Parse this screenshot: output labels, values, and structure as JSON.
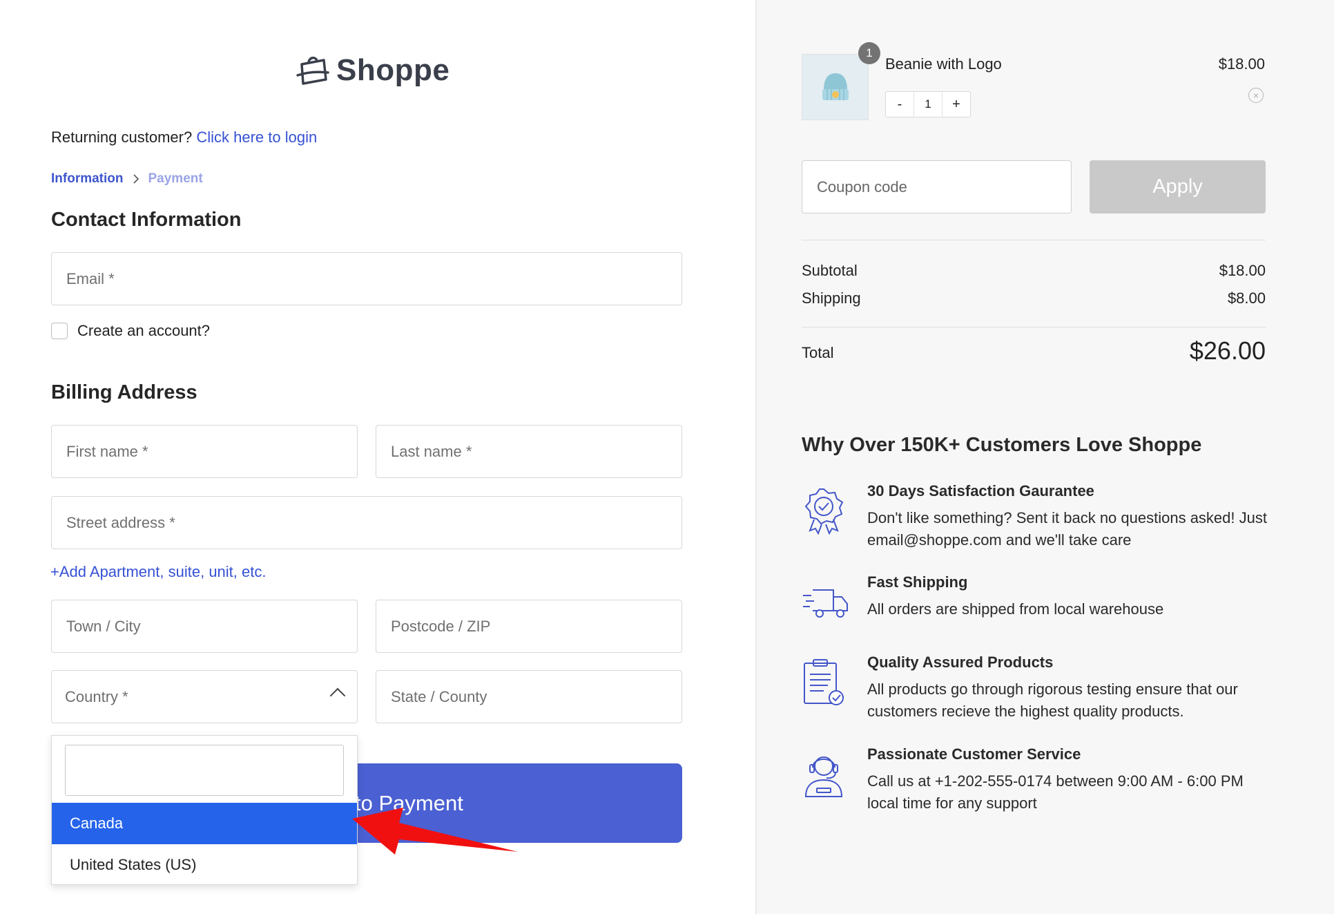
{
  "brand": {
    "name": "Shoppe"
  },
  "returning": {
    "prefix": "Returning customer?",
    "link": "Click here to login"
  },
  "breadcrumb": {
    "step1": "Information",
    "step2": "Payment"
  },
  "contact": {
    "heading": "Contact Information",
    "email_placeholder": "Email *",
    "create_account": "Create an account?"
  },
  "billing": {
    "heading": "Billing Address",
    "first_name": "First name *",
    "last_name": "Last name *",
    "street": "Street address *",
    "add_apartment": "Add Apartment, suite, unit, etc.",
    "town": "Town / City",
    "postcode": "Postcode / ZIP",
    "country": "Country *",
    "state": "State / County"
  },
  "country_dropdown": {
    "options": [
      "Canada",
      "United States (US)"
    ],
    "highlighted": "Canada"
  },
  "pay_button": {
    "label": "Continue to Payment",
    "visible_label": "to Payment"
  },
  "cart": {
    "item": {
      "name": "Beanie with Logo",
      "price": "$18.00",
      "quantity": "1",
      "badge": "1"
    },
    "qty_minus": "-",
    "qty_plus": "+"
  },
  "coupon": {
    "placeholder": "Coupon code",
    "apply": "Apply"
  },
  "summary": {
    "subtotal_label": "Subtotal",
    "subtotal": "$18.00",
    "shipping_label": "Shipping",
    "shipping": "$8.00",
    "total_label": "Total",
    "total": "$26.00"
  },
  "why": {
    "heading": "Why Over 150K+ Customers Love Shoppe",
    "features": [
      {
        "icon": "badge-check-icon",
        "title": "30 Days Satisfaction Gaurantee",
        "desc": "Don't like something? Sent it back no questions asked! Just email@shoppe.com and we'll take care"
      },
      {
        "icon": "truck-icon",
        "title": "Fast Shipping",
        "desc": "All orders are shipped from local warehouse"
      },
      {
        "icon": "clipboard-check-icon",
        "title": "Quality Assured Products",
        "desc": "All products go through rigorous testing ensure that our customers recieve the highest quality products."
      },
      {
        "icon": "support-agent-icon",
        "title": "Passionate Customer Service",
        "desc": "Call us at +1-202-555-0174 between 9:00 AM - 6:00 PM local time for any support"
      }
    ]
  },
  "colors": {
    "accent": "#3651d4",
    "button": "#4b60d2",
    "highlight": "#2563eb",
    "arrow": "#f01010"
  }
}
